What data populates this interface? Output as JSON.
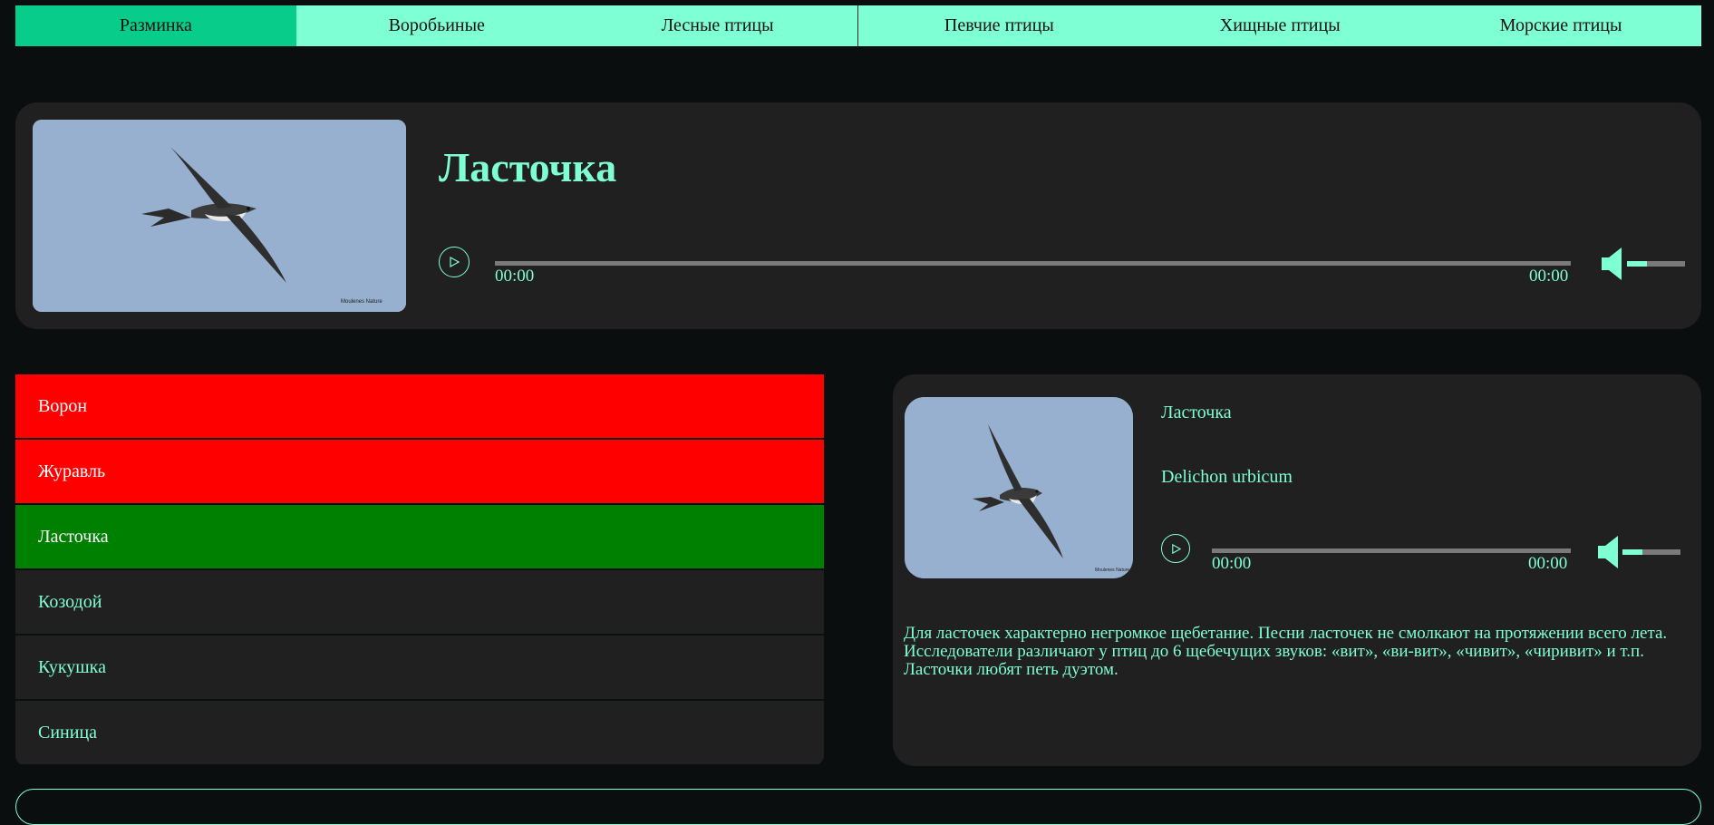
{
  "nav": {
    "items": [
      {
        "label": "Разминка",
        "active": true
      },
      {
        "label": "Воробьиные",
        "active": false
      },
      {
        "label": "Лесные птицы",
        "active": false
      },
      {
        "label": "Певчие птицы",
        "active": false
      },
      {
        "label": "Хищные птицы",
        "active": false
      },
      {
        "label": "Морские птицы",
        "active": false
      }
    ]
  },
  "hero": {
    "title": "Ласточка",
    "image_caption": "Moulenes Nature",
    "player": {
      "current_time": "00:00",
      "duration": "00:00",
      "progress": 0,
      "volume": 0.3
    }
  },
  "answers": [
    {
      "label": "Ворон",
      "state": "wrong"
    },
    {
      "label": "Журавль",
      "state": "wrong"
    },
    {
      "label": "Ласточка",
      "state": "right"
    },
    {
      "label": "Козодой",
      "state": "default"
    },
    {
      "label": "Кукушка",
      "state": "default"
    },
    {
      "label": "Синица",
      "state": "default"
    }
  ],
  "details": {
    "name": "Ласточка",
    "latin_name": "Delichon urbicum",
    "image_caption": "Moulenes Nature",
    "player": {
      "current_time": "00:00",
      "duration": "00:00",
      "progress": 0,
      "volume": 0.3
    },
    "description": "Для ласточек характерно негромкое щебетание. Песни ласточек не смолкают на протяжении всего лета. Исследователи различают у птиц до 6 щебечущих звуков: «вит», «ви-вит», «чивит», «чиривит» и т.п. Ласточки любят петь дуэтом."
  },
  "colors": {
    "accent": "#7fffd4",
    "active_tab": "#08cc8a",
    "wrong": "#ff0000",
    "right": "#008000",
    "panel": "#202020",
    "background": "#0a0e0f"
  }
}
